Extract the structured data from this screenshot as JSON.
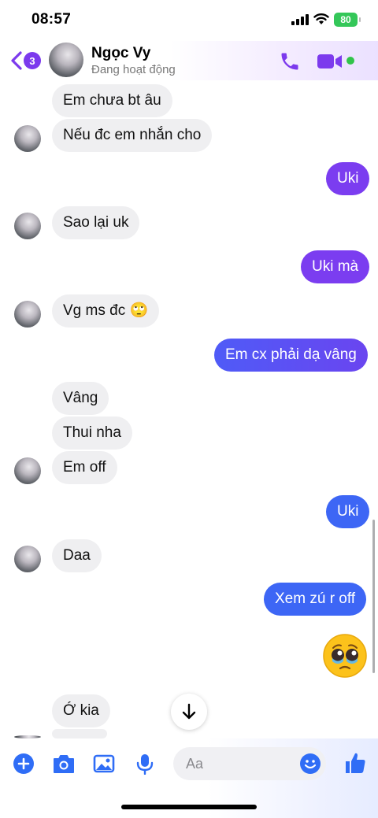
{
  "status_bar": {
    "time": "08:57",
    "battery": "80"
  },
  "header": {
    "back_count": "3",
    "contact_name": "Ngọc Vy",
    "contact_status": "Đang hoạt động"
  },
  "messages": {
    "m1": "Em chưa bt âu",
    "m2": "Nếu đc em nhắn cho",
    "m3": "Uki",
    "m4": "Sao lại uk",
    "m5": "Uki mà",
    "m6": "Vg ms đc 🙄",
    "m7": "Em cx phải dạ vâng",
    "m8": "Vâng",
    "m9": "Thui nha",
    "m10": "Em off",
    "m11": "Uki",
    "m12": "Daa",
    "m13": "Xem zú r off",
    "m14": "Ớ kia",
    "emoji_reply": "pleading-face-with-tears"
  },
  "composer": {
    "placeholder": "Aa"
  },
  "colors": {
    "accent": "#7b3df0",
    "blue": "#3d66f5",
    "incoming": "#efeff1"
  }
}
